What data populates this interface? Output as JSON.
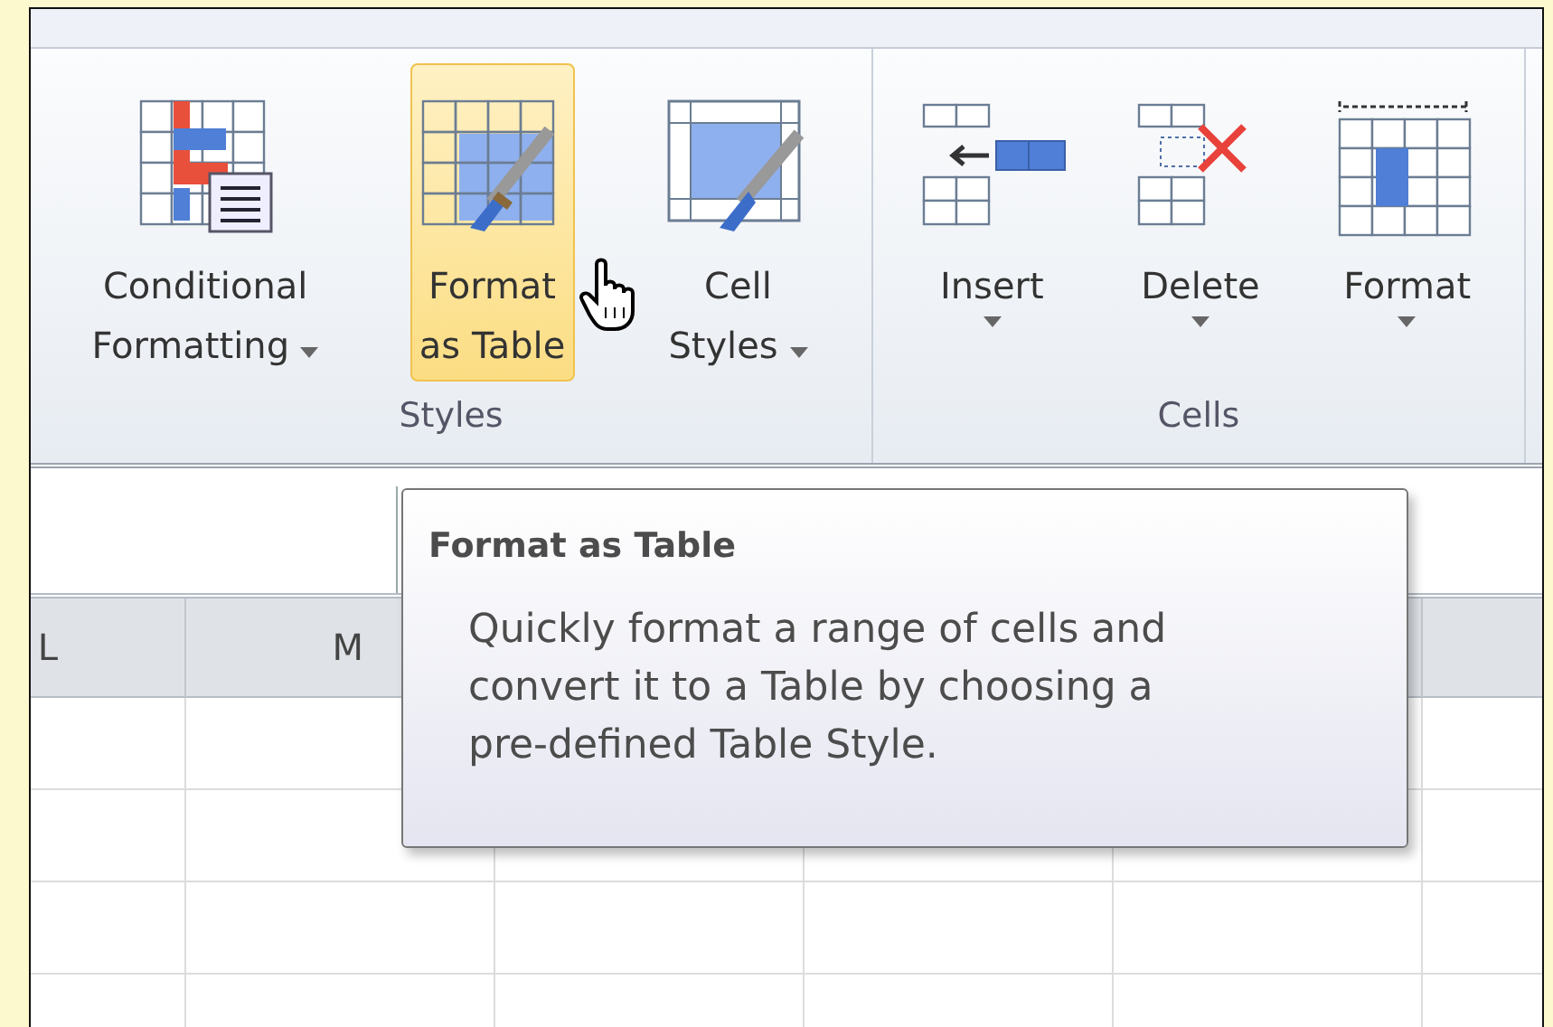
{
  "ribbon": {
    "groups": [
      {
        "label": "Styles",
        "buttons": [
          {
            "lines": [
              "Conditional",
              "Formatting"
            ],
            "kind": "conditional",
            "dropdown": true,
            "hovered": false
          },
          {
            "lines": [
              "Format",
              "as Table"
            ],
            "kind": "table",
            "dropdown": false,
            "hovered": true
          },
          {
            "lines": [
              "Cell",
              "Styles"
            ],
            "kind": "cellstyles",
            "dropdown": true,
            "hovered": false
          }
        ]
      },
      {
        "label": "Cells",
        "buttons": [
          {
            "lines": [
              "Insert"
            ],
            "kind": "insert",
            "dropdown": true,
            "hovered": false
          },
          {
            "lines": [
              "Delete"
            ],
            "kind": "delete",
            "dropdown": true,
            "hovered": false
          },
          {
            "lines": [
              "Format"
            ],
            "kind": "format",
            "dropdown": true,
            "hovered": false
          }
        ]
      }
    ]
  },
  "sheet": {
    "column_headers": [
      "L",
      "M"
    ]
  },
  "tooltip": {
    "title": "Format as Table",
    "body": "Quickly format a range of cells and convert it to a Table by choosing a pre-defined Table Style."
  }
}
